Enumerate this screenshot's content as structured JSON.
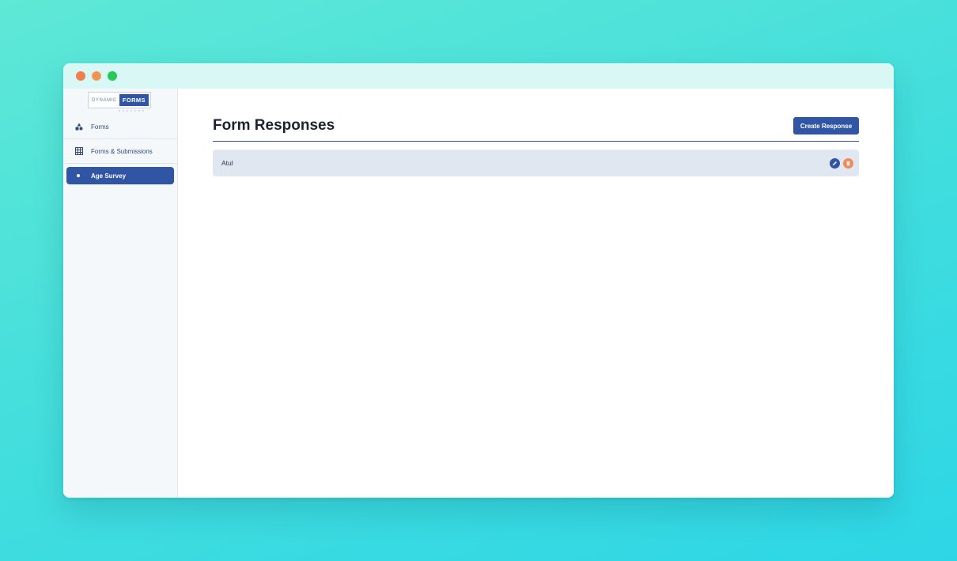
{
  "window": {
    "controls": [
      "close",
      "minimize",
      "maximize"
    ]
  },
  "sidebar": {
    "logo": {
      "left_text": "DYNAMIC",
      "right_text": "FORMS"
    },
    "items": [
      {
        "label": "Forms",
        "icon": "shapes-icon"
      },
      {
        "label": "Forms & Submissions",
        "icon": "table-icon"
      },
      {
        "label": "Age Survey",
        "icon": "dot-icon",
        "active": true
      }
    ]
  },
  "main": {
    "title": "Form Responses",
    "create_button": "Create Response",
    "responses": [
      {
        "name": "Atul",
        "actions": [
          "edit-icon",
          "delete-icon"
        ]
      }
    ]
  },
  "colors": {
    "accent": "#2f55a4",
    "danger": "#f28a57",
    "titlebar": "#d9f8f5",
    "row_bg": "#e1e7f0"
  }
}
